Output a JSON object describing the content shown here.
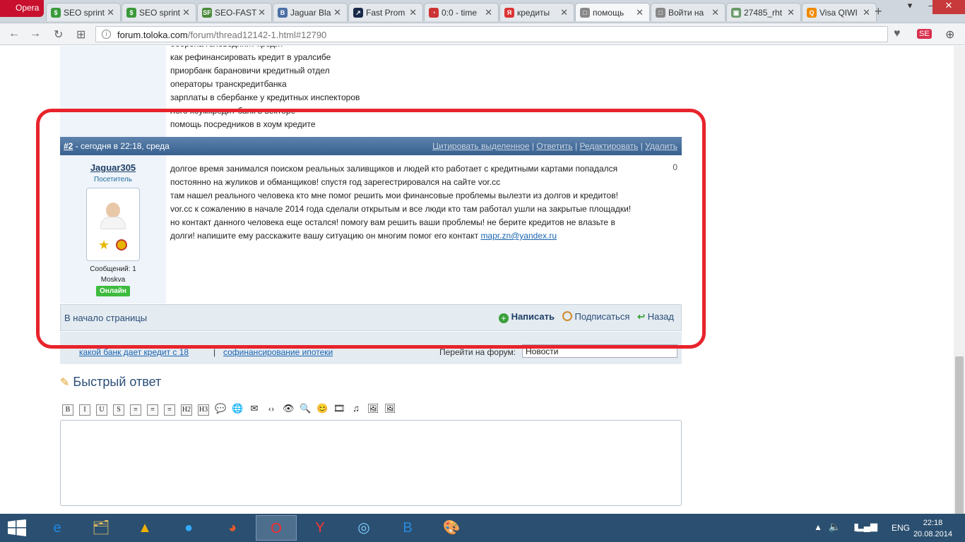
{
  "browser": {
    "menu_label": "Opera",
    "tabs": [
      {
        "label": "SEO sprint",
        "fav_color": "#3a9a3a",
        "fav": "$"
      },
      {
        "label": "SEO sprint",
        "fav_color": "#3a9a3a",
        "fav": "$"
      },
      {
        "label": "SEO-FAST",
        "fav_color": "#4a8a3a",
        "fav": "SF"
      },
      {
        "label": "Jaguar Bla",
        "fav_color": "#4a6fa5",
        "fav": "B"
      },
      {
        "label": "Fast Prom",
        "fav_color": "#1a2a4a",
        "fav": "↗"
      },
      {
        "label": "0:0 - time",
        "fav_color": "#cc3333",
        "fav": "◔"
      },
      {
        "label": "кредиты",
        "fav_color": "#dd3333",
        "fav": "Я"
      },
      {
        "label": "помощь",
        "fav_color": "#888888",
        "fav": "□"
      },
      {
        "label": "Войти на",
        "fav_color": "#888888",
        "fav": "□"
      },
      {
        "label": "27485_rht",
        "fav_color": "#6a9a6a",
        "fav": "▣"
      },
      {
        "label": "Visa QIWI",
        "fav_color": "#f08a00",
        "fav": "Q"
      }
    ],
    "active_tab_index": 7,
    "url_domain": "forum.toloka.com",
    "url_path": "/forum/thread12142-1.html#12790"
  },
  "prev_post": {
    "lines": [
      "оборона головодинит кредит",
      "как рефинансировать кредит в уралсибе",
      "приорбанк барановичи кредитный отдел",
      "операторы транскредитбанка",
      "зарплаты в сбербанке у кредитных инспекторов",
      "лого хоумкредит банк в векторе",
      "помощь посредников в хоум кредите"
    ]
  },
  "post": {
    "number": "#2",
    "date": " - сегодня в 22:18, среда",
    "actions": [
      "Цитировать выделенное",
      "Ответить",
      "Редактировать",
      "Удалить"
    ],
    "author": "Jaguar305",
    "role": "Посетитель",
    "messages": "Сообщений: 1",
    "city": "Moskva",
    "status": "Онлайн",
    "vote": "0",
    "text_lines": [
      "долгое время занимался поиском реальных заливщиков и людей кто работает с кредитными картами попадался",
      "постоянно на жуликов и обманщиков! спустя год зарегестрировался на сайте vor.cc",
      "там нашел реального человека кто мне помог решить мои финансовые проблемы вылезти из долгов и кредитов!",
      "vor.cc к сожалению в начале 2014 года сделали открытым и все люди кто там работал ушли на закрытые площадки!",
      "но контакт данного человека еще остался! помогу вам решить ваши проблемы! не берите кредитов не влазьте в"
    ],
    "last_line": "долги! напишите ему расскажите вашу ситуацию он многим помог его контакт ",
    "email": "mapr.zn@yandex.ru"
  },
  "page_bar": {
    "to_top": "В начало страницы",
    "write": "Написать",
    "subscribe": "Подписаться",
    "back": "Назад"
  },
  "nav_bar": {
    "link1": "какой банк дает кредит с 18",
    "link2": "софинансирование ипотеки",
    "separator": "|",
    "jump_label": "Перейти на форум:",
    "jump_value": "Новости"
  },
  "quick_reply": {
    "title": "Быстрый ответ",
    "tools": [
      "B",
      "I",
      "U",
      "S",
      "≡",
      "≡",
      "≡",
      "H2",
      "H3",
      "💬",
      "🌐",
      "✉",
      "‹›",
      "👁",
      "🔍",
      "😊",
      "🎞",
      "♫",
      "🖼",
      "🖼"
    ]
  },
  "taskbar": {
    "apps": [
      {
        "icon": "e",
        "color": "#1e88e5"
      },
      {
        "icon": "🗂",
        "color": "#e6c060"
      },
      {
        "icon": "▲",
        "color": "#f0b000"
      },
      {
        "icon": "●",
        "color": "#33aaff"
      },
      {
        "icon": "◕",
        "color": "#e55a2b"
      },
      {
        "icon": "O",
        "color": "#ff2a2a"
      },
      {
        "icon": "Y",
        "color": "#ff3333"
      },
      {
        "icon": "◎",
        "color": "#7fd0ff"
      },
      {
        "icon": "B",
        "color": "#2b8ae0"
      },
      {
        "icon": "🎨",
        "color": "#e6c060"
      }
    ],
    "active_app_index": 5,
    "lang": "ENG",
    "time": "22:18",
    "date": "20.08.2014"
  }
}
